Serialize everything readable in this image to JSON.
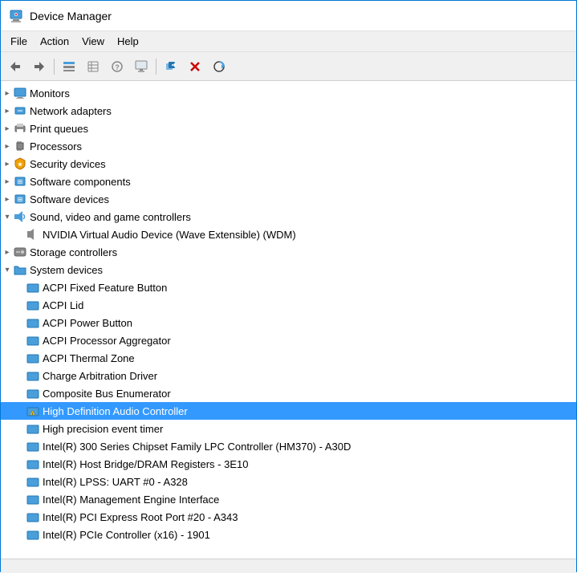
{
  "titleBar": {
    "title": "Device Manager"
  },
  "menuBar": {
    "items": [
      "File",
      "Action",
      "View",
      "Help"
    ]
  },
  "toolbar": {
    "buttons": [
      {
        "name": "back",
        "label": "←",
        "disabled": false
      },
      {
        "name": "forward",
        "label": "→",
        "disabled": false
      },
      {
        "name": "show-hidden",
        "label": "⊞",
        "disabled": false
      },
      {
        "name": "properties",
        "label": "⊟",
        "disabled": false
      },
      {
        "name": "help",
        "label": "?",
        "disabled": false
      },
      {
        "name": "device-list",
        "label": "⊠",
        "disabled": false
      },
      {
        "name": "monitor",
        "label": "⬜",
        "disabled": false
      },
      {
        "name": "uninstall",
        "label": "✖",
        "disabled": false,
        "color": "#cc0000"
      },
      {
        "name": "scan",
        "label": "⊕",
        "disabled": false
      }
    ]
  },
  "tree": {
    "items": [
      {
        "id": "monitors",
        "label": "Monitors",
        "level": 1,
        "expanded": false,
        "icon": "monitor",
        "hasChildren": true
      },
      {
        "id": "network-adapters",
        "label": "Network adapters",
        "level": 1,
        "expanded": false,
        "icon": "network",
        "hasChildren": true
      },
      {
        "id": "print-queues",
        "label": "Print queues",
        "level": 1,
        "expanded": false,
        "icon": "printer",
        "hasChildren": true
      },
      {
        "id": "processors",
        "label": "Processors",
        "level": 1,
        "expanded": false,
        "icon": "processor",
        "hasChildren": true
      },
      {
        "id": "security-devices",
        "label": "Security devices",
        "level": 1,
        "expanded": false,
        "icon": "security",
        "hasChildren": true
      },
      {
        "id": "software-components",
        "label": "Software components",
        "level": 1,
        "expanded": false,
        "icon": "software",
        "hasChildren": true
      },
      {
        "id": "software-devices",
        "label": "Software devices",
        "level": 1,
        "expanded": false,
        "icon": "software2",
        "hasChildren": true
      },
      {
        "id": "sound-video",
        "label": "Sound, video and game controllers",
        "level": 1,
        "expanded": true,
        "icon": "sound",
        "hasChildren": true
      },
      {
        "id": "nvidia-audio",
        "label": "NVIDIA Virtual Audio Device (Wave Extensible) (WDM)",
        "level": 2,
        "expanded": false,
        "icon": "audio-device",
        "hasChildren": false
      },
      {
        "id": "storage-controllers",
        "label": "Storage controllers",
        "level": 1,
        "expanded": false,
        "icon": "storage",
        "hasChildren": true
      },
      {
        "id": "system-devices",
        "label": "System devices",
        "level": 1,
        "expanded": true,
        "icon": "system",
        "hasChildren": true
      },
      {
        "id": "acpi-fixed",
        "label": "ACPI Fixed Feature Button",
        "level": 2,
        "expanded": false,
        "icon": "system-device",
        "hasChildren": false
      },
      {
        "id": "acpi-lid",
        "label": "ACPI Lid",
        "level": 2,
        "expanded": false,
        "icon": "system-device",
        "hasChildren": false
      },
      {
        "id": "acpi-power",
        "label": "ACPI Power Button",
        "level": 2,
        "expanded": false,
        "icon": "system-device",
        "hasChildren": false
      },
      {
        "id": "acpi-aggregator",
        "label": "ACPI Processor Aggregator",
        "level": 2,
        "expanded": false,
        "icon": "system-device",
        "hasChildren": false
      },
      {
        "id": "acpi-thermal",
        "label": "ACPI Thermal Zone",
        "level": 2,
        "expanded": false,
        "icon": "system-device",
        "hasChildren": false
      },
      {
        "id": "charge-arbitration",
        "label": "Charge Arbitration Driver",
        "level": 2,
        "expanded": false,
        "icon": "system-device",
        "hasChildren": false
      },
      {
        "id": "composite-bus",
        "label": "Composite Bus Enumerator",
        "level": 2,
        "expanded": false,
        "icon": "system-device",
        "hasChildren": false
      },
      {
        "id": "hd-audio",
        "label": "High Definition Audio Controller",
        "level": 2,
        "expanded": false,
        "icon": "system-device-warning",
        "hasChildren": false,
        "selected": true
      },
      {
        "id": "high-precision",
        "label": "High precision event timer",
        "level": 2,
        "expanded": false,
        "icon": "system-device",
        "hasChildren": false
      },
      {
        "id": "intel-300-chipset",
        "label": "Intel(R) 300 Series Chipset Family LPC Controller (HM370) - A30D",
        "level": 2,
        "expanded": false,
        "icon": "system-device",
        "hasChildren": false
      },
      {
        "id": "intel-host-bridge",
        "label": "Intel(R) Host Bridge/DRAM Registers - 3E10",
        "level": 2,
        "expanded": false,
        "icon": "system-device",
        "hasChildren": false
      },
      {
        "id": "intel-lpss-uart",
        "label": "Intel(R) LPSS: UART #0 - A328",
        "level": 2,
        "expanded": false,
        "icon": "system-device",
        "hasChildren": false
      },
      {
        "id": "intel-mgmt-engine",
        "label": "Intel(R) Management Engine Interface",
        "level": 2,
        "expanded": false,
        "icon": "system-device",
        "hasChildren": false
      },
      {
        "id": "intel-pci-root",
        "label": "Intel(R) PCI Express Root Port #20 - A343",
        "level": 2,
        "expanded": false,
        "icon": "system-device",
        "hasChildren": false
      },
      {
        "id": "intel-pcie-controller",
        "label": "Intel(R) PCIe Controller (x16) - 1901",
        "level": 2,
        "expanded": false,
        "icon": "system-device",
        "hasChildren": false
      }
    ]
  },
  "statusBar": {
    "text": ""
  }
}
